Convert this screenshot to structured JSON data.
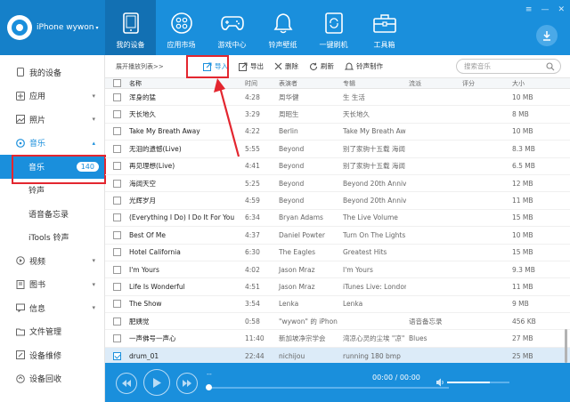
{
  "device": {
    "name": "iPhone wywon",
    "caret": "▾"
  },
  "nav": [
    {
      "label": "我的设备",
      "icon": "phone-icon"
    },
    {
      "label": "应用市场",
      "icon": "apps-grid-icon"
    },
    {
      "label": "游戏中心",
      "icon": "gamepad-icon"
    },
    {
      "label": "铃声壁纸",
      "icon": "bell-icon"
    },
    {
      "label": "一键刷机",
      "icon": "flash-device-icon"
    },
    {
      "label": "工具箱",
      "icon": "toolbox-icon"
    }
  ],
  "window_controls": {
    "menu": "≡",
    "minimize": "—",
    "close": "✕"
  },
  "sidebar": {
    "items": [
      {
        "label": "我的设备",
        "icon": "device-icon"
      },
      {
        "label": "应用",
        "icon": "app-icon"
      },
      {
        "label": "照片",
        "icon": "photo-icon"
      },
      {
        "label": "音乐",
        "icon": "music-icon"
      },
      {
        "label": "音乐",
        "badge": "140"
      },
      {
        "label": "铃声"
      },
      {
        "label": "语音备忘录"
      },
      {
        "label": "iTools 铃声"
      },
      {
        "label": "视频",
        "icon": "video-icon"
      },
      {
        "label": "图书",
        "icon": "book-icon"
      },
      {
        "label": "信息",
        "icon": "message-icon"
      },
      {
        "label": "文件管理",
        "icon": "folder-icon"
      },
      {
        "label": "设备维修",
        "icon": "repair-icon"
      },
      {
        "label": "设备回收",
        "icon": "recycle-icon"
      }
    ]
  },
  "toolbar": {
    "crumb": "展开播放列表>>",
    "import": "导入",
    "export": "导出",
    "delete": "删除",
    "refresh": "刷新",
    "ringtone": "铃声制作",
    "search_placeholder": "搜索音乐"
  },
  "table": {
    "headers": {
      "name": "名称",
      "time": "时间",
      "artist": "表演者",
      "album": "专辑",
      "genre": "流派",
      "rating": "评分",
      "size": "大小"
    },
    "rows": [
      {
        "name": "浑身的猛",
        "time": "4:28",
        "artist": "周华健",
        "album": "生 生活",
        "genre": "",
        "size": "10 MB",
        "checked": false
      },
      {
        "name": "天长地久",
        "time": "3:29",
        "artist": "周昭生",
        "album": "天长地久",
        "genre": "",
        "size": "8 MB",
        "checked": false
      },
      {
        "name": "Take My Breath Away",
        "time": "4:22",
        "artist": "Berlin",
        "album": "Take My Breath Aw",
        "genre": "",
        "size": "10 MB",
        "checked": false
      },
      {
        "name": "无泪的遗憾(Live)",
        "time": "5:55",
        "artist": "Beyond",
        "album": "别了家驹十五载 海阔",
        "genre": "",
        "size": "8.3 MB",
        "checked": false
      },
      {
        "name": "再见理想(Live)",
        "time": "4:41",
        "artist": "Beyond",
        "album": "别了家驹十五载 海阔",
        "genre": "",
        "size": "6.5 MB",
        "checked": false
      },
      {
        "name": "海阔天空",
        "time": "5:25",
        "artist": "Beyond",
        "album": "Beyond 20th Annive",
        "genre": "",
        "size": "12 MB",
        "checked": false
      },
      {
        "name": "光辉岁月",
        "time": "4:59",
        "artist": "Beyond",
        "album": "Beyond 20th Annive",
        "genre": "",
        "size": "11 MB",
        "checked": false
      },
      {
        "name": "(Everything I Do) I Do It For You",
        "time": "6:34",
        "artist": "Bryan Adams",
        "album": "The Live Volume",
        "genre": "",
        "size": "15 MB",
        "checked": false
      },
      {
        "name": "Best Of Me",
        "time": "4:37",
        "artist": "Daniel Powter",
        "album": "Turn On The Lights",
        "genre": "",
        "size": "10 MB",
        "checked": false
      },
      {
        "name": "Hotel California",
        "time": "6:30",
        "artist": "The Eagles",
        "album": "Greatest Hits",
        "genre": "",
        "size": "15 MB",
        "checked": false
      },
      {
        "name": "I'm Yours",
        "time": "4:02",
        "artist": "Jason Mraz",
        "album": "I'm Yours",
        "genre": "",
        "size": "9.3 MB",
        "checked": false
      },
      {
        "name": "Life Is Wonderful",
        "time": "4:51",
        "artist": "Jason Mraz",
        "album": "iTunes Live: London",
        "genre": "",
        "size": "11 MB",
        "checked": false
      },
      {
        "name": "The Show",
        "time": "3:54",
        "artist": "Lenka",
        "album": "Lenka",
        "genre": "",
        "size": "9 MB",
        "checked": false
      },
      {
        "name": "肥姨觉",
        "time": "0:58",
        "artist": "\"wywon\" 的 iPhon",
        "album": "",
        "genre": "语音备忘录",
        "size": "456 KB",
        "checked": false
      },
      {
        "name": "一声佛号一声心",
        "time": "11:40",
        "artist": "新加坡净宗学会",
        "album": "湾凉心灵的尘埃 \"凉\"",
        "genre": "Blues",
        "size": "27 MB",
        "checked": false
      },
      {
        "name": "drum_01",
        "time": "22:44",
        "artist": "nichijou",
        "album": "running 180 bmp",
        "genre": "",
        "size": "25 MB",
        "checked": true
      }
    ]
  },
  "player": {
    "title": "--",
    "time": "00:00 / 00:00",
    "progress": 0.0,
    "volume": 0.68
  },
  "colors": {
    "accent": "#1a8fdc",
    "highlight": "#e3262f"
  }
}
